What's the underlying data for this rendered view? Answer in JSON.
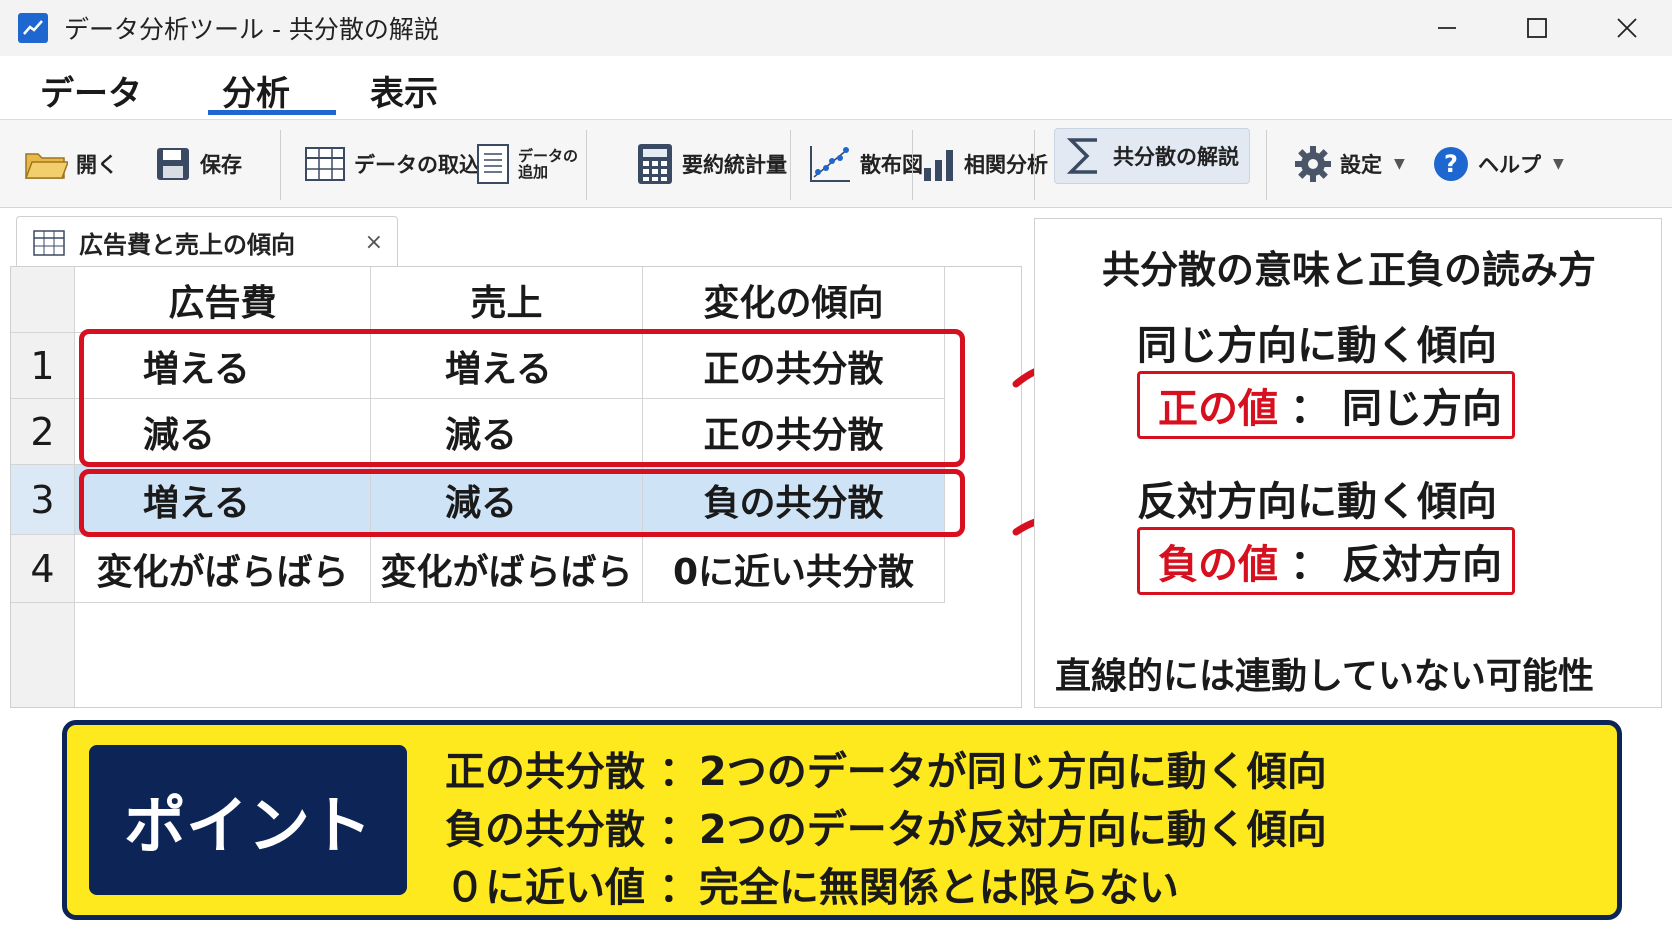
{
  "window": {
    "title": "データ分析ツール - 共分散の解説",
    "icon": "chart-line-icon",
    "accent_color": "#1e66d0"
  },
  "menu": {
    "items": [
      "データ",
      "分析",
      "表示"
    ],
    "active": "分析"
  },
  "toolbar": {
    "open": "開く",
    "save": "保存",
    "import": "データの取込",
    "append_line1": "データの",
    "append_line2": "追加",
    "summary": "要約統計量",
    "scatter": "散布図",
    "correlation": "相関分析",
    "covariance": "共分散の解説",
    "settings": "設定",
    "help": "ヘルプ"
  },
  "doc_tab": {
    "label": "広告費と売上の傾向",
    "close": "×"
  },
  "table": {
    "columns": [
      "広告費",
      "売上",
      "変化の傾向"
    ],
    "rows": [
      {
        "index": "1",
        "cells": [
          "増える",
          "増える",
          "正の共分散"
        ]
      },
      {
        "index": "2",
        "cells": [
          "減る",
          "減る",
          "正の共分散"
        ]
      },
      {
        "index": "3",
        "cells": [
          "増える",
          "減る",
          "負の共分散"
        ]
      },
      {
        "index": "4",
        "cells": [
          "変化がばらばら",
          "変化がばらばら",
          "0に近い共分散"
        ]
      }
    ],
    "selected_row": "3"
  },
  "explain": {
    "title": "共分散の意味と正負の読み方",
    "positive_heading": "同じ方向に動く傾向",
    "positive_label": "正の値",
    "positive_colon": "：",
    "positive_desc": "同じ方向",
    "negative_heading": "反対方向に動く傾向",
    "negative_label": "負の値",
    "negative_colon": "：",
    "negative_desc": "反対方向",
    "zero_note": "直線的には連動していない可能性"
  },
  "point": {
    "badge": "ポイント",
    "lines": [
      "正の共分散 ：2つのデータが同じ方向に動く傾向",
      "負の共分散 ：2つのデータが反対方向に動く傾向",
      "０に近い値 ：完全に無関係とは限らない"
    ]
  },
  "colors": {
    "highlight_red": "#d6101e",
    "selection_blue": "#cfe3f6",
    "banner_yellow": "#fde91d",
    "banner_navy": "#0d2457"
  }
}
